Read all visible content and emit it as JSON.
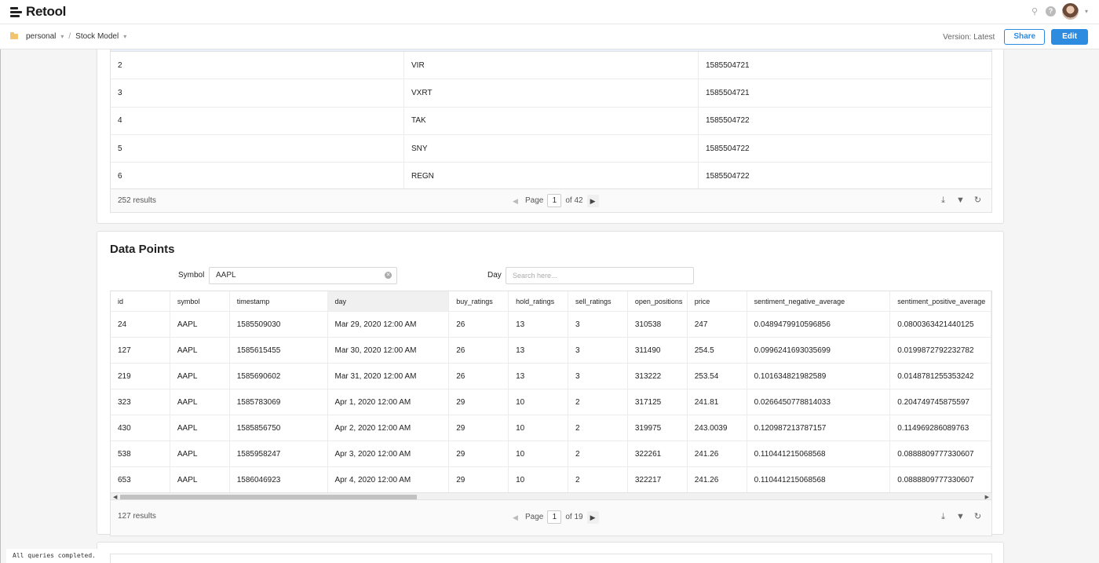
{
  "app": {
    "logo_text": "Retool"
  },
  "breadcrumb": {
    "folder": "personal",
    "app_name": "Stock Model",
    "separator": "/"
  },
  "header": {
    "version_text": "Version: Latest",
    "share_label": "Share",
    "edit_label": "Edit"
  },
  "top_table": {
    "rows": [
      [
        "2",
        "VIR",
        "1585504721"
      ],
      [
        "3",
        "VXRT",
        "1585504721"
      ],
      [
        "4",
        "TAK",
        "1585504722"
      ],
      [
        "5",
        "SNY",
        "1585504722"
      ],
      [
        "6",
        "REGN",
        "1585504722"
      ]
    ],
    "results_text": "252 results",
    "page_label": "Page",
    "page_current": "1",
    "page_total": "of 42"
  },
  "data_points": {
    "title": "Data Points",
    "symbol_label": "Symbol",
    "symbol_value": "AAPL",
    "day_label": "Day",
    "day_placeholder": "Search here...",
    "columns": [
      "id",
      "symbol",
      "timestamp",
      "day",
      "buy_ratings",
      "hold_ratings",
      "sell_ratings",
      "open_positions",
      "price",
      "sentiment_negative_average",
      "sentiment_positive_average"
    ],
    "rows": [
      [
        "24",
        "AAPL",
        "1585509030",
        "Mar 29, 2020 12:00 AM",
        "26",
        "13",
        "3",
        "310538",
        "247",
        "0.0489479910596856",
        "0.0800363421440125"
      ],
      [
        "127",
        "AAPL",
        "1585615455",
        "Mar 30, 2020 12:00 AM",
        "26",
        "13",
        "3",
        "311490",
        "254.5",
        "0.0996241693035699",
        "0.0199872792232782"
      ],
      [
        "219",
        "AAPL",
        "1585690602",
        "Mar 31, 2020 12:00 AM",
        "26",
        "13",
        "3",
        "313222",
        "253.54",
        "0.101634821982589",
        "0.0148781255353242"
      ],
      [
        "323",
        "AAPL",
        "1585783069",
        "Apr 1, 2020 12:00 AM",
        "29",
        "10",
        "2",
        "317125",
        "241.81",
        "0.0266450778814033",
        "0.204749745875597"
      ],
      [
        "430",
        "AAPL",
        "1585856750",
        "Apr 2, 2020 12:00 AM",
        "29",
        "10",
        "2",
        "319975",
        "243.0039",
        "0.120987213787157",
        "0.114969286089763"
      ],
      [
        "538",
        "AAPL",
        "1585958247",
        "Apr 3, 2020 12:00 AM",
        "29",
        "10",
        "2",
        "322261",
        "241.26",
        "0.110441215068568",
        "0.0888809777330607"
      ],
      [
        "653",
        "AAPL",
        "1586046923",
        "Apr 4, 2020 12:00 AM",
        "29",
        "10",
        "2",
        "322217",
        "241.26",
        "0.110441215068568",
        "0.0888809777330607"
      ]
    ],
    "results_text": "127 results",
    "page_label": "Page",
    "page_current": "1",
    "page_total": "of 19"
  },
  "status": {
    "toast": "All queries completed."
  },
  "colors": {
    "accent": "#2d8be0",
    "folder": "#f2c46d"
  },
  "icons": [
    "search-icon",
    "help-icon",
    "chevron-down-icon",
    "folder-icon",
    "download-icon",
    "filter-icon",
    "refresh-icon",
    "clear-icon"
  ]
}
